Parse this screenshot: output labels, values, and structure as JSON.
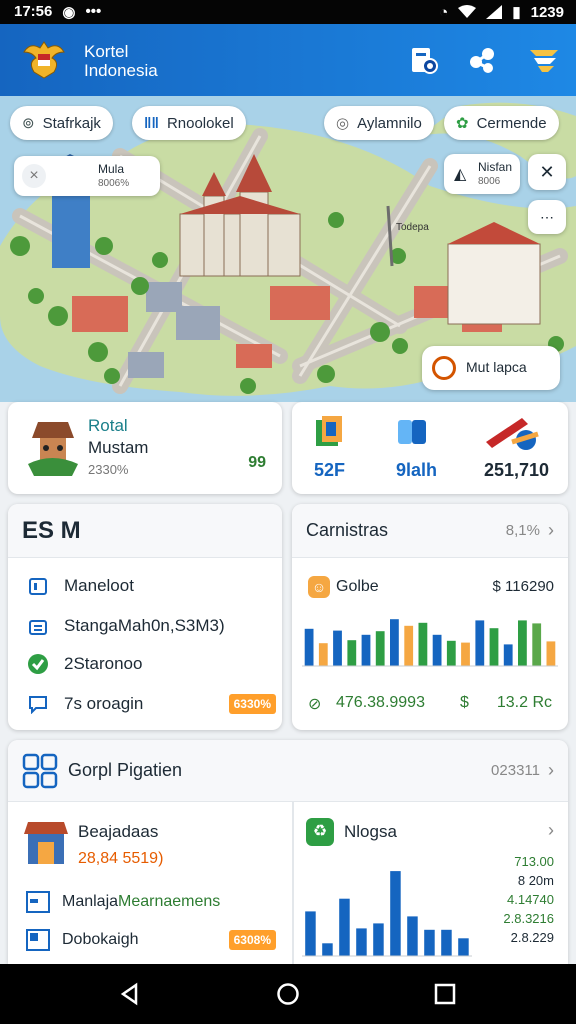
{
  "status": {
    "time": "17:56",
    "battery": "1239"
  },
  "header": {
    "title_line1": "Kortel",
    "title_line2": "Indonesia"
  },
  "map_chips": [
    {
      "label": "Stafrkajk"
    },
    {
      "label": "Rnoolokel"
    },
    {
      "label": "Aylamnilo"
    },
    {
      "label": "Cermende"
    }
  ],
  "map_pins": {
    "left_title": "Mula",
    "left_sub": "8006%",
    "right_title": "Nisfan",
    "right_sub": "8006",
    "road_label": "Todepa",
    "callout": "Mut lapca"
  },
  "stat_card_left": {
    "title": "Rotal",
    "subtitle": "Mustam",
    "percent": "2330%",
    "value": "99"
  },
  "stat_card_right": {
    "values": [
      "52F",
      "9lalh",
      "251,710"
    ]
  },
  "list_card": {
    "title": "ES M",
    "items": [
      {
        "label": "Maneloot"
      },
      {
        "label": "StangaMah0n,S3M3)"
      },
      {
        "label": "2Staronoo"
      },
      {
        "label": "7s oroagin",
        "badge": "6330%"
      }
    ]
  },
  "chart_card": {
    "title": "Carnistras",
    "meta": "8,1%",
    "series_label": "Golbe",
    "series_value": "$ 116290",
    "footer_left": "476.38.9993",
    "footer_right": "13.2 Rc"
  },
  "bottom_card": {
    "title": "Gorpl Pigatien",
    "meta": "023311",
    "item1_title": "Beajadaas",
    "item1_value": "28,84 5519)",
    "item2_prefix": "Manlaja",
    "item2_suffix": "Mearnaemens",
    "item3_label": "Dobokaigh",
    "item3_badge": "6308%"
  },
  "sub_chart": {
    "title": "Nlogsa",
    "values": [
      "713.00",
      "8 20m",
      "4.14740",
      "2.8.3216",
      "2.8.229"
    ]
  },
  "chart_data": [
    {
      "type": "bar",
      "categories": [
        "",
        "",
        "",
        "",
        "",
        "",
        "",
        "",
        "",
        "",
        "",
        "",
        "",
        "",
        "",
        "",
        "",
        ""
      ],
      "series": [
        {
          "values": [
            6.2,
            3.8,
            5.9,
            4.3,
            5.2,
            5.8,
            7.8,
            6.7,
            7.2,
            5.2,
            4.2,
            3.9,
            7.6,
            6.3,
            3.6,
            7.6,
            7.1,
            4.1
          ]
        }
      ],
      "ylim": [
        0,
        10
      ],
      "colors": [
        "#1565c0",
        "#f5a742",
        "#1565c0",
        "#2e9e44",
        "#1565c0",
        "#2e9e44",
        "#1565c0",
        "#f5a742",
        "#2e9e44",
        "#1565c0",
        "#2e9e44",
        "#f5a742",
        "#1565c0",
        "#2e9e44",
        "#1565c0",
        "#2e9e44",
        "#5aa84a",
        "#f5a742"
      ]
    },
    {
      "type": "bar",
      "categories": [
        "",
        "",
        "",
        "",
        "",
        "",
        "",
        "",
        "",
        ""
      ],
      "series": [
        {
          "values": [
            6.3,
            1.8,
            8.1,
            3.9,
            4.6,
            12.0,
            5.6,
            3.7,
            3.7,
            2.5
          ]
        }
      ],
      "ylim": [
        0,
        13
      ]
    }
  ],
  "nav": {
    "back": "back",
    "home": "home",
    "recents": "recents"
  }
}
